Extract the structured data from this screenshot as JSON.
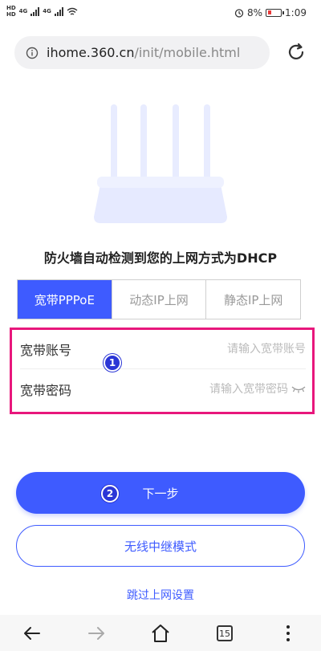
{
  "status_bar": {
    "battery": "8%",
    "time": "1:09",
    "network_labels": [
      "4G",
      "4G"
    ]
  },
  "browser": {
    "url_host": "ihome.360.cn",
    "url_path": "/init/mobile.html"
  },
  "page": {
    "headline": "防火墙自动检测到您的上网方式为DHCP",
    "tabs": [
      {
        "label": "宽带PPPoE",
        "active": true
      },
      {
        "label": "动态IP上网",
        "active": false
      },
      {
        "label": "静态IP上网",
        "active": false
      }
    ],
    "form": {
      "account_label": "宽带账号",
      "account_placeholder": "请输入宽带账号",
      "password_label": "宽带密码",
      "password_placeholder": "请输入宽带密码"
    },
    "markers": {
      "one": "1",
      "two": "2"
    },
    "next_button": "下一步",
    "relay_button": "无线中继模式",
    "skip_link": "跳过上网设置"
  },
  "nav": {
    "tab_count": "15"
  },
  "colors": {
    "accent": "#3e5bff",
    "highlight_border": "#e8177c",
    "router": "#e8ecff"
  },
  "icons": [
    "info-icon",
    "reload-icon",
    "eye-closed-icon",
    "back-icon",
    "forward-icon",
    "home-icon",
    "tabs-icon",
    "more-icon",
    "alarm-icon",
    "wifi-icon",
    "battery-icon"
  ]
}
